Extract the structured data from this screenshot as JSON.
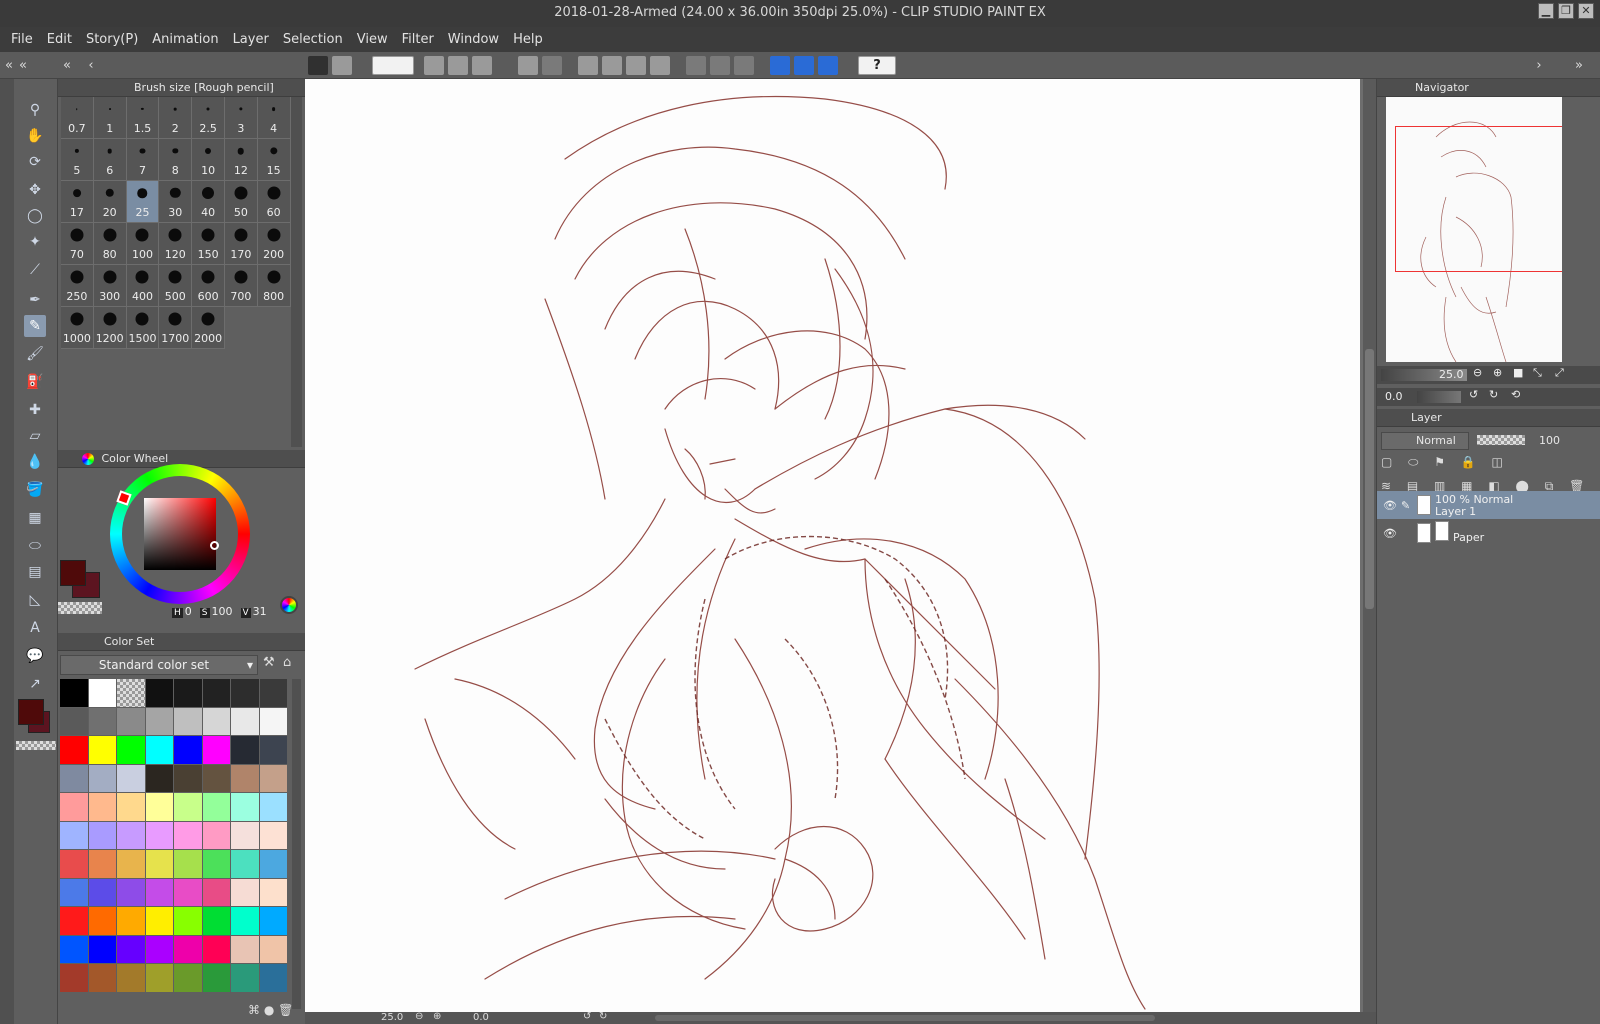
{
  "window": {
    "title": "2018-01-28-Armed (24.00 x 36.00in 350dpi 25.0%)  - CLIP STUDIO PAINT EX",
    "controls": [
      "▁",
      "❐",
      "✕"
    ]
  },
  "menu": [
    "File",
    "Edit",
    "Story(P)",
    "Animation",
    "Layer",
    "Selection",
    "View",
    "Filter",
    "Window",
    "Help"
  ],
  "brush_panel": {
    "title": "Brush size [Rough pencil]",
    "sizes": [
      "0.7",
      "1",
      "1.5",
      "2",
      "2.5",
      "3",
      "4",
      "5",
      "6",
      "7",
      "8",
      "10",
      "12",
      "15",
      "17",
      "20",
      "25",
      "30",
      "40",
      "50",
      "60",
      "70",
      "80",
      "100",
      "120",
      "150",
      "170",
      "200",
      "250",
      "300",
      "400",
      "500",
      "600",
      "700",
      "800",
      "1000",
      "1200",
      "1500",
      "1700",
      "2000"
    ],
    "selected": "25"
  },
  "color_wheel": {
    "title": "Color Wheel",
    "h_label": "H",
    "h_value": "0",
    "s_label": "S",
    "s_value": "100",
    "v_label": "V",
    "v_value": "31",
    "main_color": "#4f0a0a",
    "sub_color": "#5c1420"
  },
  "color_set": {
    "title": "Color Set",
    "selected_set": "Standard color set",
    "colors": [
      "#000000",
      "#ffffff",
      "checker",
      "#111111",
      "#1a1a1a",
      "#222222",
      "#2d2d2d",
      "#3a3a3a",
      "#5a5a5a",
      "#707070",
      "#8a8a8a",
      "#a5a5a5",
      "#bfbfbf",
      "#d6d6d6",
      "#e8e8e8",
      "#f5f5f5",
      "#ff0000",
      "#ffff00",
      "#00ff00",
      "#00ffff",
      "#0000ff",
      "#ff00ff",
      "#262a33",
      "#3d4450",
      "#7f8aa0",
      "#a3adc3",
      "#c9cfe0",
      "#2b2620",
      "#4a4033",
      "#645340",
      "#b0846a",
      "#c4a08a",
      "#ff9b9b",
      "#ffb98d",
      "#ffd98d",
      "#ffff99",
      "#c8ff8a",
      "#93ff9a",
      "#9bffe0",
      "#9be0ff",
      "#9fb4ff",
      "#a99bff",
      "#c79bff",
      "#e89bff",
      "#ff9be6",
      "#ff9bc4",
      "#f5e0dc",
      "#fde1d4",
      "#e84c4c",
      "#e8844c",
      "#e8b44c",
      "#e6e24c",
      "#a6e04c",
      "#4ce05a",
      "#4ce0bf",
      "#4ca8e0",
      "#4c7ae8",
      "#5c4ce8",
      "#8e4ce8",
      "#c44ce8",
      "#e84cc6",
      "#e84c86",
      "#f6dcd4",
      "#fde0cc",
      "#ff1a1a",
      "#ff6a00",
      "#ffaa00",
      "#ffee00",
      "#88ff00",
      "#00dd33",
      "#00ffcc",
      "#00aaff",
      "#0055ff",
      "#0000ff",
      "#6600ff",
      "#aa00ff",
      "#ee00aa",
      "#ff0055",
      "#e8c4b4",
      "#f0c4a8",
      "#a33a2a",
      "#a3582a",
      "#a37a2a",
      "#9f9f2a",
      "#6a9a2a",
      "#2a9a3a",
      "#2a9a7a",
      "#2a6f9a"
    ]
  },
  "navigator": {
    "title": "Navigator",
    "zoom": "25.0",
    "rotation": "0.0"
  },
  "layer_panel": {
    "title": "Layer",
    "blend_mode": "Normal",
    "opacity": "100",
    "layers": [
      {
        "info": "100 % Normal",
        "name": "Layer 1",
        "selected": true
      },
      {
        "info": "",
        "name": "Paper",
        "selected": false
      }
    ]
  },
  "status": {
    "zoom": "25.0",
    "rotation": "0.0"
  },
  "accent": "#7a8da3",
  "sketch_color": "#8b3a34",
  "icons": [
    "zoom-icon",
    "hand-icon",
    "rotate-icon",
    "move-icon",
    "lasso-icon",
    "wand-icon",
    "eyedropper-icon",
    "pen-icon",
    "pencil-icon",
    "brush-icon",
    "airbrush-icon",
    "decoration-icon",
    "eraser-icon",
    "blend-icon",
    "fill-icon",
    "gradient-icon",
    "figure-icon",
    "frame-icon",
    "ruler-icon",
    "text-icon",
    "balloon-icon",
    "line-correction-icon"
  ]
}
